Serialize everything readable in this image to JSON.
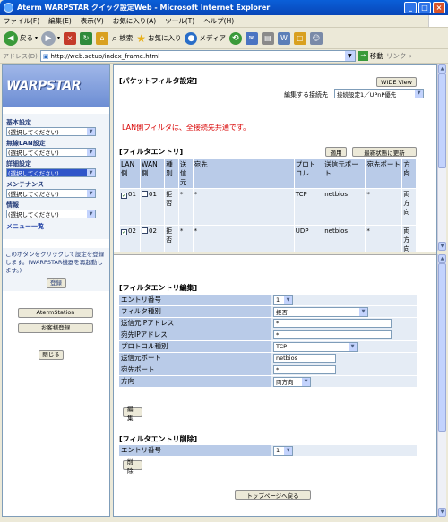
{
  "window": {
    "title": "Aterm WARPSTAR クイック設定Web - Microsoft Internet Explorer"
  },
  "menu": [
    "ファイル(F)",
    "編集(E)",
    "表示(V)",
    "お気に入り(A)",
    "ツール(T)",
    "ヘルプ(H)"
  ],
  "toolbar": {
    "back": "戻る",
    "search": "検索",
    "favorites": "お気に入り",
    "media": "メディア"
  },
  "address": {
    "label": "アドレス(D)",
    "url": "http://web.setup/index_frame.html",
    "go": "移動",
    "links": "リンク"
  },
  "sidebar": {
    "logo": "WARPSTAR",
    "basic_label": "基本設定",
    "basic_value": "(選択してください)",
    "wlan_label": "無線LAN設定",
    "wlan_value": "(選択してください)",
    "detail_label": "詳細設定",
    "detail_value": "(選択してください)",
    "maint_label": "メンテナンス",
    "maint_value": "(選択してください)",
    "info_label": "情報",
    "info_value": "(選択してください)",
    "menu_list": "メニュー一覧",
    "note": "このボタンをクリックして設定を登録します。(WARPSTAR機器を再起動します。)",
    "register_btn": "登録",
    "aterm_station_btn": "AtermStation",
    "customer_btn": "お客様登録",
    "close_btn": "閉じる"
  },
  "top": {
    "title": "[パケットフィルタ設定]",
    "wide_view": "WIDE View",
    "conn_label": "編集する接続先",
    "conn_value": "接続設定1／UPnP優先",
    "lan_note": "LAN側フィルタは、全接続先共通です。",
    "entries_title": "[フィルタエントリ]",
    "apply_btn": "適用",
    "refresh_btn": "最新状態に更新",
    "headers": [
      "LAN側",
      "WAN側",
      "種別",
      "送信元",
      "宛先",
      "プロトコル",
      "送信元ポート",
      "宛先ポート",
      "方向"
    ],
    "rows": [
      {
        "lan": "01",
        "wan": "01",
        "type": "拒否",
        "src": "*",
        "dst": "*",
        "proto": "TCP",
        "sport": "netbios",
        "dport": "*",
        "dir": "両方向"
      },
      {
        "lan": "02",
        "wan": "02",
        "type": "拒否",
        "src": "*",
        "dst": "*",
        "proto": "UDP",
        "sport": "netbios",
        "dport": "*",
        "dir": "両方向"
      }
    ]
  },
  "edit": {
    "title": "[フィルタエントリ編集]",
    "entry_no_label": "エントリ番号",
    "entry_no_value": "1",
    "filter_type_label": "フィルタ種別",
    "filter_type_value": "拒否",
    "src_ip_label": "送信元IPアドレス",
    "src_ip_value": "*",
    "dst_ip_label": "宛先IPアドレス",
    "dst_ip_value": "*",
    "proto_label": "プロトコル種別",
    "proto_value": "TCP",
    "src_port_label": "送信元ポート",
    "src_port_value": "netbios",
    "dst_port_label": "宛先ポート",
    "dst_port_value": "*",
    "dir_label": "方向",
    "dir_value": "両方向",
    "edit_btn": "編集"
  },
  "delete": {
    "title": "[フィルタエントリ削除]",
    "entry_no_label": "エントリ番号",
    "entry_no_value": "1",
    "delete_btn": "削除"
  },
  "footer": {
    "top_page_btn": "トップページへ戻る"
  }
}
